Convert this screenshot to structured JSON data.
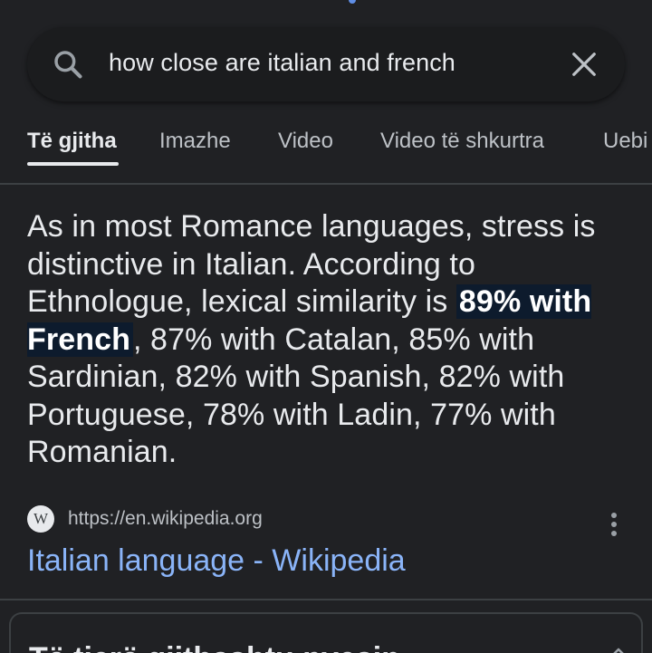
{
  "search": {
    "query": "how close are italian and french"
  },
  "tabs": [
    {
      "label": "Të gjitha",
      "active": true
    },
    {
      "label": "Imazhe",
      "active": false
    },
    {
      "label": "Video",
      "active": false
    },
    {
      "label": "Video të shkurtra",
      "active": false
    },
    {
      "label": "Uebi",
      "active": false
    }
  ],
  "snippet": {
    "before": "As in most Romance languages, stress is distinctive in Italian. According to Ethnologue, lexical similarity is ",
    "highlight": "89% with French",
    "after": ", 87% with Catalan, 85% with Sardinian, 82% with Spanish, 82% with Portuguese, 78% with Ladin, 77% with Romanian."
  },
  "source": {
    "favicon_letter": "W",
    "url": "https://en.wikipedia.org",
    "title": "Italian language - Wikipedia"
  },
  "next_card": {
    "title": "Të tjerë gjithashtu pyesin"
  },
  "icons": {
    "search": "search-icon",
    "clear": "close-icon",
    "more": "more-vert-icon",
    "chevron": "chevron-up-icon"
  },
  "colors": {
    "background": "#202124",
    "link": "#8ab4f8",
    "highlight_bg": "#0d1b2d"
  }
}
